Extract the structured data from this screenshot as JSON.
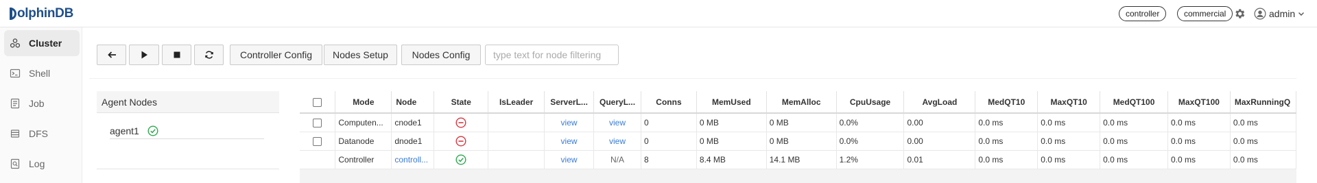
{
  "header": {
    "logo_text": "olphinDB",
    "badge_controller": "controller",
    "badge_commercial": "commercial",
    "user": "admin",
    "icons": [
      "gear-icon",
      "user-avatar-icon",
      "chevron-down-icon"
    ]
  },
  "sidebar": {
    "items": [
      {
        "label": "Cluster",
        "icon": "cluster-icon",
        "active": true
      },
      {
        "label": "Shell",
        "icon": "shell-icon",
        "active": false
      },
      {
        "label": "Job",
        "icon": "job-icon",
        "active": false
      },
      {
        "label": "DFS",
        "icon": "dfs-icon",
        "active": false
      },
      {
        "label": "Log",
        "icon": "log-icon",
        "active": false
      }
    ]
  },
  "toolbar": {
    "back_icon": "arrow-left-icon",
    "start_icon": "play-icon",
    "stop_icon": "stop-icon",
    "refresh_icon": "refresh-icon",
    "controller_config": "Controller Config",
    "nodes_setup": "Nodes Setup",
    "nodes_config": "Nodes Config",
    "filter_placeholder": "type text for node filtering"
  },
  "agent_panel": {
    "title": "Agent Nodes",
    "agents": [
      {
        "name": "agent1",
        "status": "running"
      }
    ]
  },
  "nodes_table": {
    "columns": [
      "Mode",
      "Node",
      "State",
      "IsLeader",
      "ServerL...",
      "QueryL...",
      "Conns",
      "MemUsed",
      "MemAlloc",
      "CpuUsage",
      "AvgLoad",
      "MedQT10",
      "MaxQT10",
      "MedQT100",
      "MaxQT100",
      "MaxRunningQ"
    ],
    "rows": [
      {
        "mode": "Computen...",
        "node": "cnode1",
        "state": "stopped",
        "isleader": "",
        "server_log": "view",
        "query_log": "view",
        "conns": "0",
        "memused": "0 MB",
        "memalloc": "0 MB",
        "cpuusage": "0.0%",
        "avgload": "0.00",
        "medqt10": "0.0 ms",
        "maxqt10": "0.0 ms",
        "medqt100": "0.0 ms",
        "maxqt100": "0.0 ms",
        "maxrunningq": "0.0 ms"
      },
      {
        "mode": "Datanode",
        "node": "dnode1",
        "state": "stopped",
        "isleader": "",
        "server_log": "view",
        "query_log": "view",
        "conns": "0",
        "memused": "0 MB",
        "memalloc": "0 MB",
        "cpuusage": "0.0%",
        "avgload": "0.00",
        "medqt10": "0.0 ms",
        "maxqt10": "0.0 ms",
        "medqt100": "0.0 ms",
        "maxqt100": "0.0 ms",
        "maxrunningq": "0.0 ms"
      },
      {
        "mode": "Controller",
        "node": "controll...",
        "state": "running",
        "isleader": "",
        "server_log": "view",
        "query_log": "N/A",
        "conns": "8",
        "memused": "8.4 MB",
        "memalloc": "14.1 MB",
        "cpuusage": "1.2%",
        "avgload": "0.01",
        "medqt10": "0.0 ms",
        "maxqt10": "0.0 ms",
        "medqt100": "0.0 ms",
        "maxqt100": "0.0 ms",
        "maxrunningq": "0.0 ms"
      }
    ]
  },
  "colors": {
    "brand": "#1f4f8a",
    "link": "#3a7bd5",
    "stopped": "#d9363e",
    "running": "#2fa84f"
  }
}
